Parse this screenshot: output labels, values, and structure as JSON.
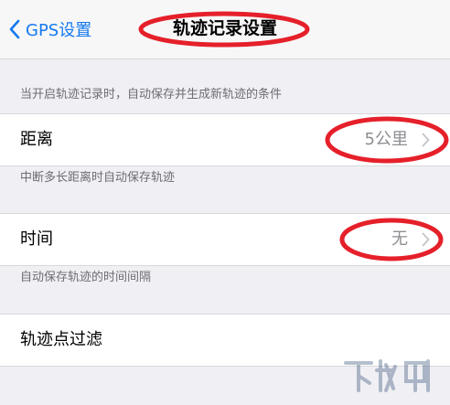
{
  "nav": {
    "back_label": "GPS设置",
    "title": "轨迹记录设置"
  },
  "sections": {
    "header": "当开启轨迹记录时，自动保存并生成新轨迹的条件",
    "distance": {
      "label": "距离",
      "value": "5公里",
      "footer": "中断多长距离时自动保存轨迹"
    },
    "time": {
      "label": "时间",
      "value": "无",
      "footer": "自动保存轨迹的时间间隔"
    },
    "filter": {
      "label": "轨迹点过滤"
    }
  },
  "colors": {
    "accent": "#1479ef",
    "annotation": "#e5202a",
    "background": "#efeff4",
    "secondary_text": "#8e8e93"
  },
  "icons": {
    "back": "chevron-left-icon",
    "disclosure": "chevron-right-icon"
  }
}
